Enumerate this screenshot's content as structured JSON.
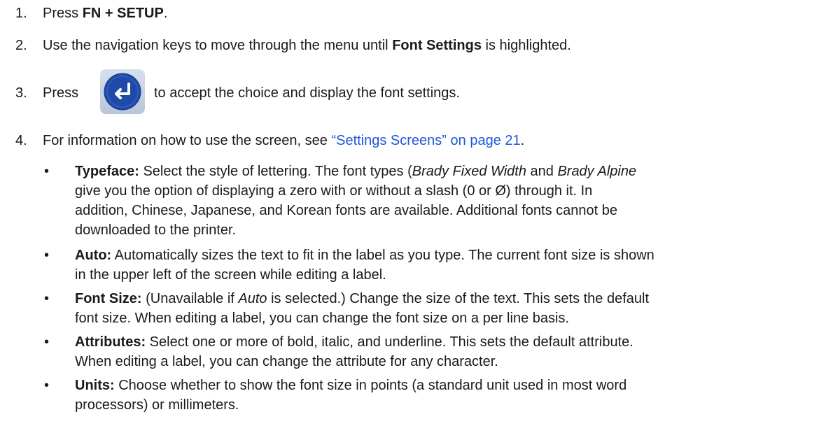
{
  "steps": {
    "s1": {
      "num": "1.",
      "prefix": "Press ",
      "bold": "FN + SETUP",
      "suffix": "."
    },
    "s2": {
      "num": "2.",
      "prefix": "Use the navigation keys to move through the menu until ",
      "bold": "Font Settings",
      "suffix": " is highlighted."
    },
    "s3": {
      "num": "3.",
      "prefix": "Press",
      "suffix": "to accept the choice and display the font settings.",
      "icon": "enter-key-icon",
      "icon_color": "#1f4aa8"
    },
    "s4": {
      "num": "4.",
      "prefix": "For information on how to use the screen, see ",
      "link": "“Settings Screens” on page 21",
      "suffix": "."
    }
  },
  "bullets": {
    "symbol": "•",
    "typeface": {
      "label": "Typeface:",
      "line1_a": " Select the style of lettering. The font types (",
      "italic1": "Brady Fixed Width",
      "line1_b": " and ",
      "italic2": "Brady Alpine",
      "line2": "give you the option of displaying a zero with or without a slash (0 or Ø) through it. In",
      "line3": "addition, Chinese, Japanese, and Korean fonts are available. Additional fonts cannot be",
      "line4": "downloaded to the printer."
    },
    "auto": {
      "label": "Auto:",
      "line1": " Automatically sizes the text to fit in the label as you type. The current font size is shown",
      "line2": "in the upper left of the screen while editing a label."
    },
    "font_size": {
      "label": "Font Size:",
      "line1_a": " (Unavailable if ",
      "italic": "Auto",
      "line1_b": " is selected.) Change the size of the text. This sets the default",
      "line2": "font size. When editing a label, you can change the font size on a per line basis."
    },
    "attributes": {
      "label": "Attributes:",
      "line1": " Select one or more of bold, italic, and underline. This sets the default attribute.",
      "line2": "When editing a label, you can change the attribute for any character."
    },
    "units": {
      "label": "Units:",
      "line1": " Choose whether to show the font size in points (a standard unit used in most word",
      "line2": "processors) or millimeters."
    }
  }
}
